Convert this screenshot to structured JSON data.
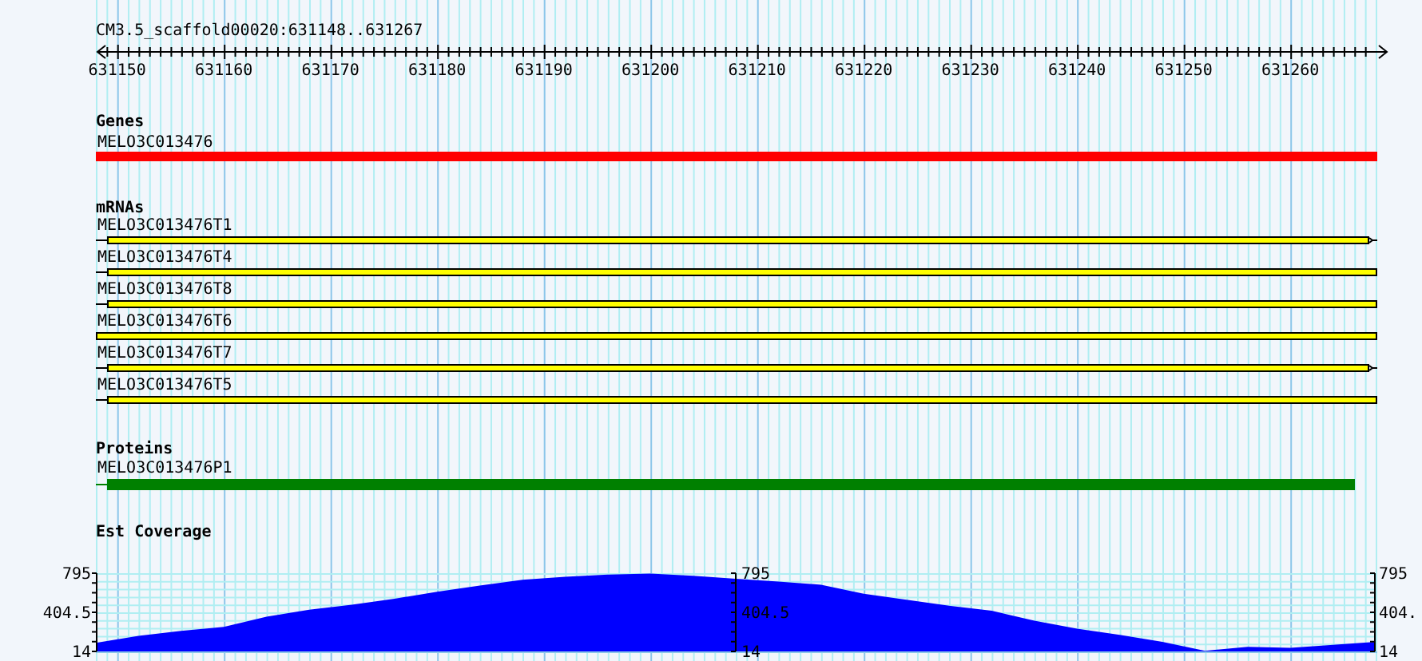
{
  "ruler": {
    "title": "CM3.5_scaffold00020:631148..631267",
    "labels": [
      "631150",
      "631160",
      "631170",
      "631180",
      "631190",
      "631200",
      "631210",
      "631220",
      "631230",
      "631240",
      "631250",
      "631260"
    ]
  },
  "tracks": [
    {
      "kind": "gene",
      "title": "Genes",
      "features": [
        {
          "name": "MELO3C013476"
        }
      ]
    },
    {
      "kind": "mrna",
      "title": "mRNAs",
      "features": [
        {
          "name": "MELO3C013476T1",
          "leading_line": true,
          "end_arrow": true
        },
        {
          "name": "MELO3C013476T4",
          "leading_line": true,
          "end_arrow": false
        },
        {
          "name": "MELO3C013476T8",
          "leading_line": true,
          "end_arrow": false
        },
        {
          "name": "MELO3C013476T6",
          "leading_line": false,
          "end_arrow": false
        },
        {
          "name": "MELO3C013476T7",
          "leading_line": true,
          "end_arrow": true
        },
        {
          "name": "MELO3C013476T5",
          "leading_line": true,
          "end_arrow": false
        }
      ]
    },
    {
      "kind": "protein",
      "title": "Proteins",
      "features": [
        {
          "name": "MELO3C013476P1"
        }
      ]
    },
    {
      "kind": "coverage",
      "middle_axis_labels": [
        "795",
        "404.5",
        "14"
      ],
      "right_axis_labels": [
        "795",
        "404.",
        "14"
      ],
      "chart_data": {
        "type": "area",
        "title": "Est Coverage",
        "categories": [
          null,
          null,
          null,
          null,
          null,
          null,
          null,
          null,
          null,
          null,
          null,
          null,
          null,
          null,
          null,
          null,
          null,
          null,
          null,
          null,
          null,
          null,
          null,
          null,
          null,
          null,
          null,
          null,
          null,
          null,
          null
        ],
        "series": [
          {
            "color": "#0000ff",
            "values": [
              100,
              170,
              220,
              260,
              360,
              430,
              480,
              540,
              610,
              670,
              730,
              760,
              780,
              790,
              770,
              740,
              710,
              680,
              590,
              530,
              470,
              420,
              320,
              240,
              180,
              110,
              20,
              60,
              50,
              80,
              110
            ]
          }
        ],
        "ylim": [
          14,
          795
        ],
        "yticks": [
          14,
          404.5,
          795
        ]
      }
    }
  ]
}
